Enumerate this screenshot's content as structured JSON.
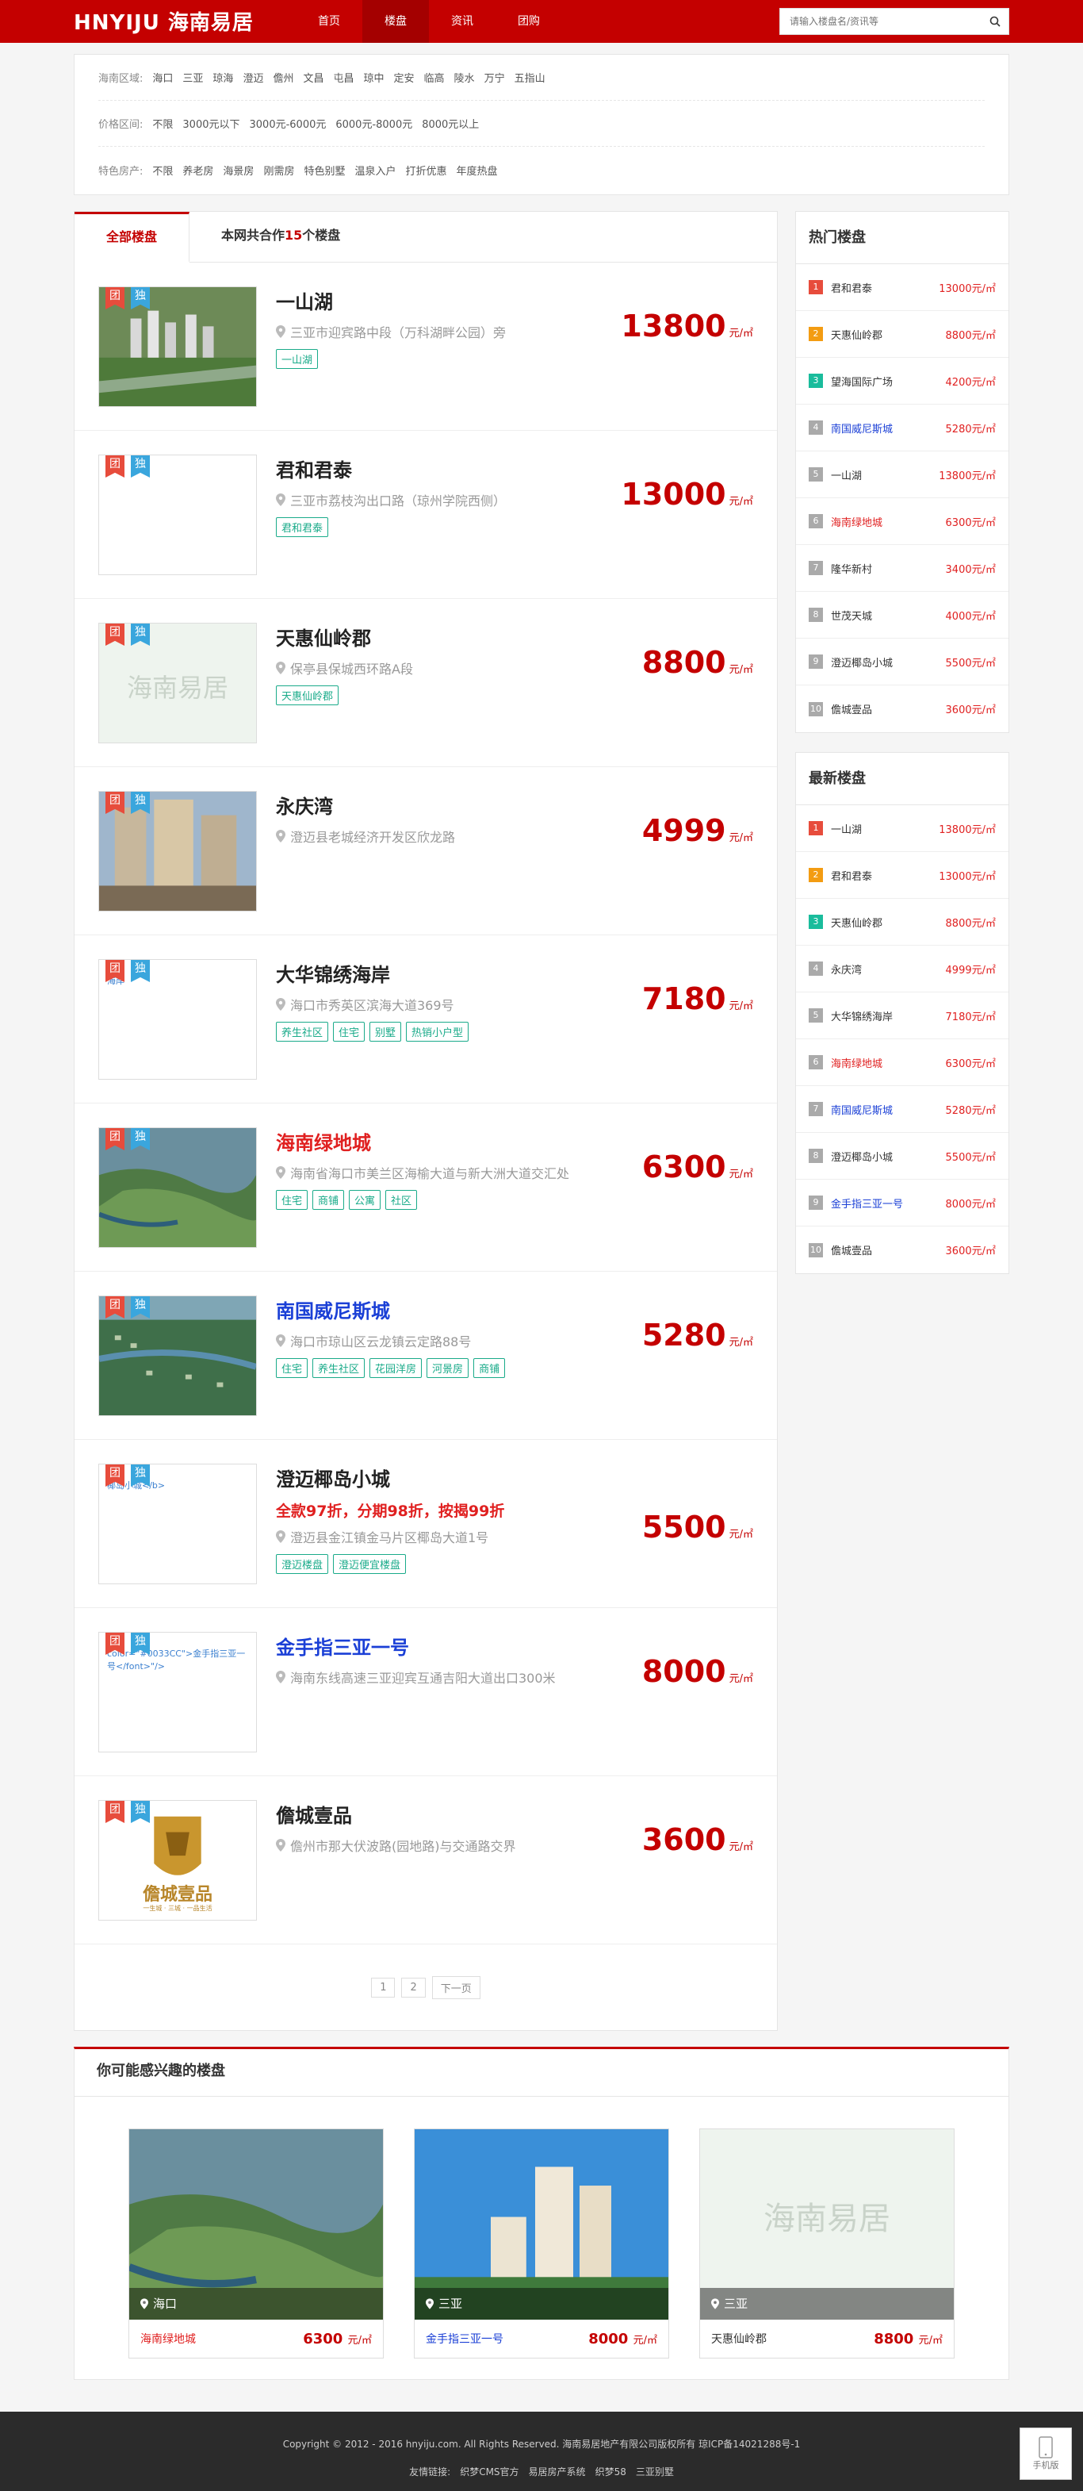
{
  "header": {
    "logo": "HNYIJU 海南易居",
    "nav": [
      {
        "label": "首页"
      },
      {
        "label": "楼盘"
      },
      {
        "label": "资讯"
      },
      {
        "label": "团购"
      }
    ],
    "search_placeholder": "请输入楼盘名/资讯等"
  },
  "filter": {
    "region_label": "海南区域:",
    "regions": [
      "海口",
      "三亚",
      "琼海",
      "澄迈",
      "儋州",
      "文昌",
      "屯昌",
      "琼中",
      "定安",
      "临高",
      "陵水",
      "万宁",
      "五指山"
    ],
    "price_label": "价格区间:",
    "prices": [
      "不限",
      "3000元以下",
      "3000元-6000元",
      "6000元-8000元",
      "8000元以上"
    ],
    "feature_label": "特色房产:",
    "features": [
      "不限",
      "养老房",
      "海景房",
      "刚需房",
      "特色别墅",
      "温泉入户",
      "打折优惠",
      "年度热盘"
    ]
  },
  "tabs": {
    "all": "全部楼盘",
    "coop_prefix": "本网共合作",
    "coop_count": "15",
    "coop_suffix": "个楼盘"
  },
  "badge": {
    "tuan": "团",
    "du": "独"
  },
  "price_unit": "元/㎡",
  "listings": [
    {
      "name": "一山湖",
      "style": "",
      "promo": "",
      "address": "三亚市迎宾路中段（万科湖畔公园）旁",
      "tags": [
        "一山湖"
      ],
      "price": "13800",
      "img": "green"
    },
    {
      "name": "君和君泰",
      "style": "",
      "promo": "",
      "address": "三亚市荔枝沟出口路（琼州学院西侧）",
      "tags": [
        "君和君泰"
      ],
      "price": "13000",
      "img": "blank"
    },
    {
      "name": "天惠仙岭郡",
      "style": "",
      "promo": "",
      "address": "保亭县保城西环路A段",
      "tags": [
        "天惠仙岭郡"
      ],
      "price": "8800",
      "img": "placeholder"
    },
    {
      "name": "永庆湾",
      "style": "",
      "promo": "",
      "address": "澄迈县老城经济开发区欣龙路",
      "tags": [],
      "price": "4999",
      "img": "tower"
    },
    {
      "name": "大华锦绣海岸",
      "style": "",
      "promo": "",
      "address": "海口市秀英区滨海大道369号",
      "tags": [
        "养生社区",
        "住宅",
        "别墅",
        "热销小户型"
      ],
      "price": "7180",
      "img": "blank",
      "img_text": "海岸"
    },
    {
      "name": "海南绿地城",
      "style": "red",
      "promo": "",
      "address": "海南省海口市美兰区海榆大道与新大洲大道交汇处",
      "tags": [
        "住宅",
        "商铺",
        "公寓",
        "社区"
      ],
      "price": "6300",
      "img": "aerial"
    },
    {
      "name": "南国威尼斯城",
      "style": "blue",
      "promo": "",
      "address": "海口市琼山区云龙镇云定路88号",
      "tags": [
        "住宅",
        "养生社区",
        "花园洋房",
        "河景房",
        "商铺"
      ],
      "price": "5280",
      "img": "aerial2"
    },
    {
      "name": "澄迈椰岛小城",
      "style": "",
      "promo": "全款97折，分期98折，按揭99折",
      "address": "澄迈县金江镇金马片区椰岛大道1号",
      "tags": [
        "澄迈楼盘",
        "澄迈便宜楼盘"
      ],
      "price": "5500",
      "img": "blank",
      "img_text": "椰岛小城</b>"
    },
    {
      "name": "金手指三亚一号",
      "style": "blue",
      "promo": "",
      "address": "海南东线高速三亚迎宾互通吉阳大道出口300米",
      "tags": [],
      "price": "8000",
      "img": "blank",
      "img_text": "color=\"#0033CC\">金手指三亚一号</font>\"/>"
    },
    {
      "name": "儋城壹品",
      "style": "",
      "promo": "",
      "address": "儋州市那大伏波路(园地路)与交通路交界",
      "tags": [],
      "price": "3600",
      "img": "logo",
      "logo_text": "儋城壹品",
      "logo_sub": "一生城 · 三城 · 一品生活"
    }
  ],
  "pager": [
    "1",
    "2",
    "下一页"
  ],
  "hot": {
    "title": "热门楼盘",
    "items": [
      {
        "n": "1",
        "name": "君和君泰",
        "price": "13000元/㎡",
        "style": ""
      },
      {
        "n": "2",
        "name": "天惠仙岭郡",
        "price": "8800元/㎡",
        "style": ""
      },
      {
        "n": "3",
        "name": "望海国际广场",
        "price": "4200元/㎡",
        "style": ""
      },
      {
        "n": "4",
        "name": "南国威尼斯城",
        "price": "5280元/㎡",
        "style": "blue"
      },
      {
        "n": "5",
        "name": "一山湖",
        "price": "13800元/㎡",
        "style": ""
      },
      {
        "n": "6",
        "name": "海南绿地城",
        "price": "6300元/㎡",
        "style": "red"
      },
      {
        "n": "7",
        "name": "隆华新村",
        "price": "3400元/㎡",
        "style": ""
      },
      {
        "n": "8",
        "name": "世茂天城",
        "price": "4000元/㎡",
        "style": ""
      },
      {
        "n": "9",
        "name": "澄迈椰岛小城",
        "price": "5500元/㎡",
        "style": ""
      },
      {
        "n": "10",
        "name": "儋城壹品",
        "price": "3600元/㎡",
        "style": ""
      }
    ]
  },
  "newest": {
    "title": "最新楼盘",
    "items": [
      {
        "n": "1",
        "name": "一山湖",
        "price": "13800元/㎡",
        "style": ""
      },
      {
        "n": "2",
        "name": "君和君泰",
        "price": "13000元/㎡",
        "style": ""
      },
      {
        "n": "3",
        "name": "天惠仙岭郡",
        "price": "8800元/㎡",
        "style": ""
      },
      {
        "n": "4",
        "name": "永庆湾",
        "price": "4999元/㎡",
        "style": ""
      },
      {
        "n": "5",
        "name": "大华锦绣海岸",
        "price": "7180元/㎡",
        "style": ""
      },
      {
        "n": "6",
        "name": "海南绿地城",
        "price": "6300元/㎡",
        "style": "red"
      },
      {
        "n": "7",
        "name": "南国威尼斯城",
        "price": "5280元/㎡",
        "style": "blue"
      },
      {
        "n": "8",
        "name": "澄迈椰岛小城",
        "price": "5500元/㎡",
        "style": ""
      },
      {
        "n": "9",
        "name": "金手指三亚一号",
        "price": "8000元/㎡",
        "style": "blue"
      },
      {
        "n": "10",
        "name": "儋城壹品",
        "price": "3600元/㎡",
        "style": ""
      }
    ]
  },
  "interest": {
    "title": "你可能感兴趣的楼盘",
    "cards": [
      {
        "loc": "海口",
        "name": "海南绿地城",
        "price": "6300",
        "unit": "元/㎡",
        "style": "red",
        "img": "aerial"
      },
      {
        "loc": "三亚",
        "name": "金手指三亚一号",
        "price": "8000",
        "unit": "元/㎡",
        "style": "blue",
        "img": "sky"
      },
      {
        "loc": "三亚",
        "name": "天惠仙岭郡",
        "price": "8800",
        "unit": "元/㎡",
        "style": "dark",
        "img": "placeholder"
      }
    ]
  },
  "placeholder_text": "海南易居",
  "footer": {
    "copyright": "Copyright © 2012 - 2016 hnyiju.com. All Rights Reserved. 海南易居地产有限公司版权所有 琼ICP备14021288号-1",
    "links_label": "友情链接:",
    "links": [
      "织梦CMS官方",
      "易居房产系统",
      "织梦58",
      "三亚别墅"
    ],
    "mobile": "手机版"
  }
}
